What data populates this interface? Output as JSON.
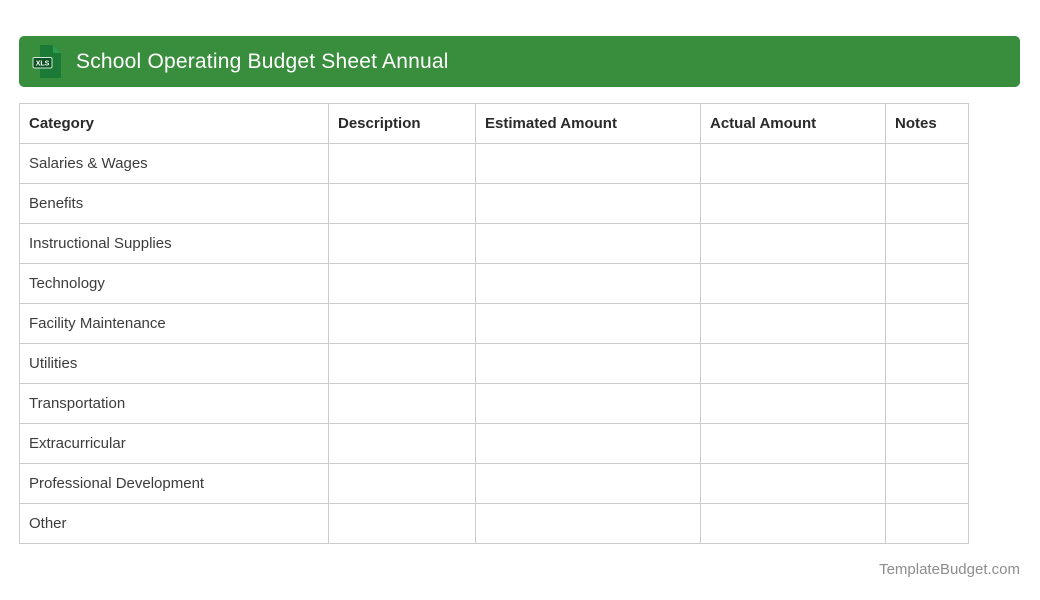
{
  "banner": {
    "title": "School Operating Budget Sheet Annual",
    "icon_label": "XLS",
    "background_color": "#388e3c",
    "icon_body_color": "#1b7a35",
    "icon_badge_color": "#0c5223"
  },
  "table": {
    "columns": [
      "Category",
      "Description",
      "Estimated Amount",
      "Actual Amount",
      "Notes"
    ],
    "rows": [
      {
        "category": "Salaries & Wages",
        "description": "",
        "estimated_amount": "",
        "actual_amount": "",
        "notes": ""
      },
      {
        "category": "Benefits",
        "description": "",
        "estimated_amount": "",
        "actual_amount": "",
        "notes": ""
      },
      {
        "category": "Instructional Supplies",
        "description": "",
        "estimated_amount": "",
        "actual_amount": "",
        "notes": ""
      },
      {
        "category": "Technology",
        "description": "",
        "estimated_amount": "",
        "actual_amount": "",
        "notes": ""
      },
      {
        "category": "Facility Maintenance",
        "description": "",
        "estimated_amount": "",
        "actual_amount": "",
        "notes": ""
      },
      {
        "category": "Utilities",
        "description": "",
        "estimated_amount": "",
        "actual_amount": "",
        "notes": ""
      },
      {
        "category": "Transportation",
        "description": "",
        "estimated_amount": "",
        "actual_amount": "",
        "notes": ""
      },
      {
        "category": "Extracurricular",
        "description": "",
        "estimated_amount": "",
        "actual_amount": "",
        "notes": ""
      },
      {
        "category": "Professional Development",
        "description": "",
        "estimated_amount": "",
        "actual_amount": "",
        "notes": ""
      },
      {
        "category": "Other",
        "description": "",
        "estimated_amount": "",
        "actual_amount": "",
        "notes": ""
      }
    ]
  },
  "footer": {
    "watermark": "TemplateBudget.com"
  }
}
